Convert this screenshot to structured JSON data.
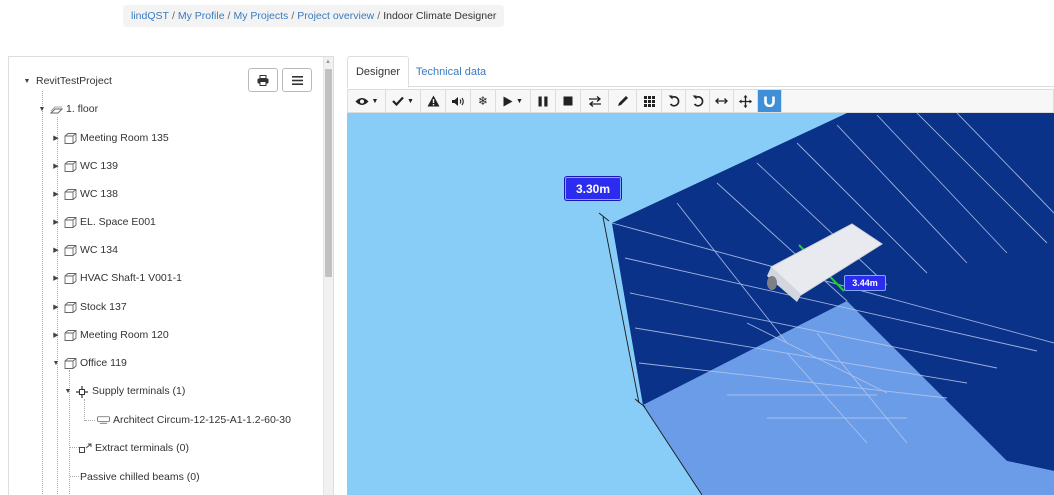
{
  "breadcrumb": {
    "items": [
      "lindQST",
      "My Profile",
      "My Projects",
      "Project overview"
    ],
    "current": "Indoor Climate Designer",
    "separator": "/"
  },
  "tree": {
    "root": "RevitTestProject",
    "floor": "1. floor",
    "rooms": [
      "Meeting Room 135",
      "WC 139",
      "WC 138",
      "EL. Space E001",
      "WC 134",
      "HVAC Shaft-1 V001-1",
      "Stock 137",
      "Meeting Room 120",
      "Office 119"
    ],
    "office_children": {
      "supply": "Supply terminals (1)",
      "supply_item": "Architect Circum-12-125-A1-1.2-60-30",
      "extract": "Extract terminals (0)",
      "beams": "Passive chilled beams (0)"
    },
    "actions": [
      "print-icon",
      "menu-icon"
    ]
  },
  "tabs": {
    "designer": "Designer",
    "technical": "Technical data"
  },
  "toolbar": {
    "buttons": [
      "eye-icon",
      "check-icon",
      "warning-icon",
      "sound-icon",
      "snowflake-icon",
      "play-icon",
      "pause-icon",
      "stop-icon",
      "swap-icon",
      "pencil-icon",
      "grid-icon",
      "undo-icon",
      "redo-icon",
      "width-icon",
      "move-icon",
      "magnet-icon"
    ]
  },
  "viewport": {
    "height_label": "3.30m",
    "distance_label": "3.44m",
    "colors": {
      "background": "#87cdf7",
      "wall": "#0b3289",
      "floor": "#6fa0ea",
      "label": "#2c2cf0",
      "magnet_active": "#3f8ed8"
    }
  }
}
